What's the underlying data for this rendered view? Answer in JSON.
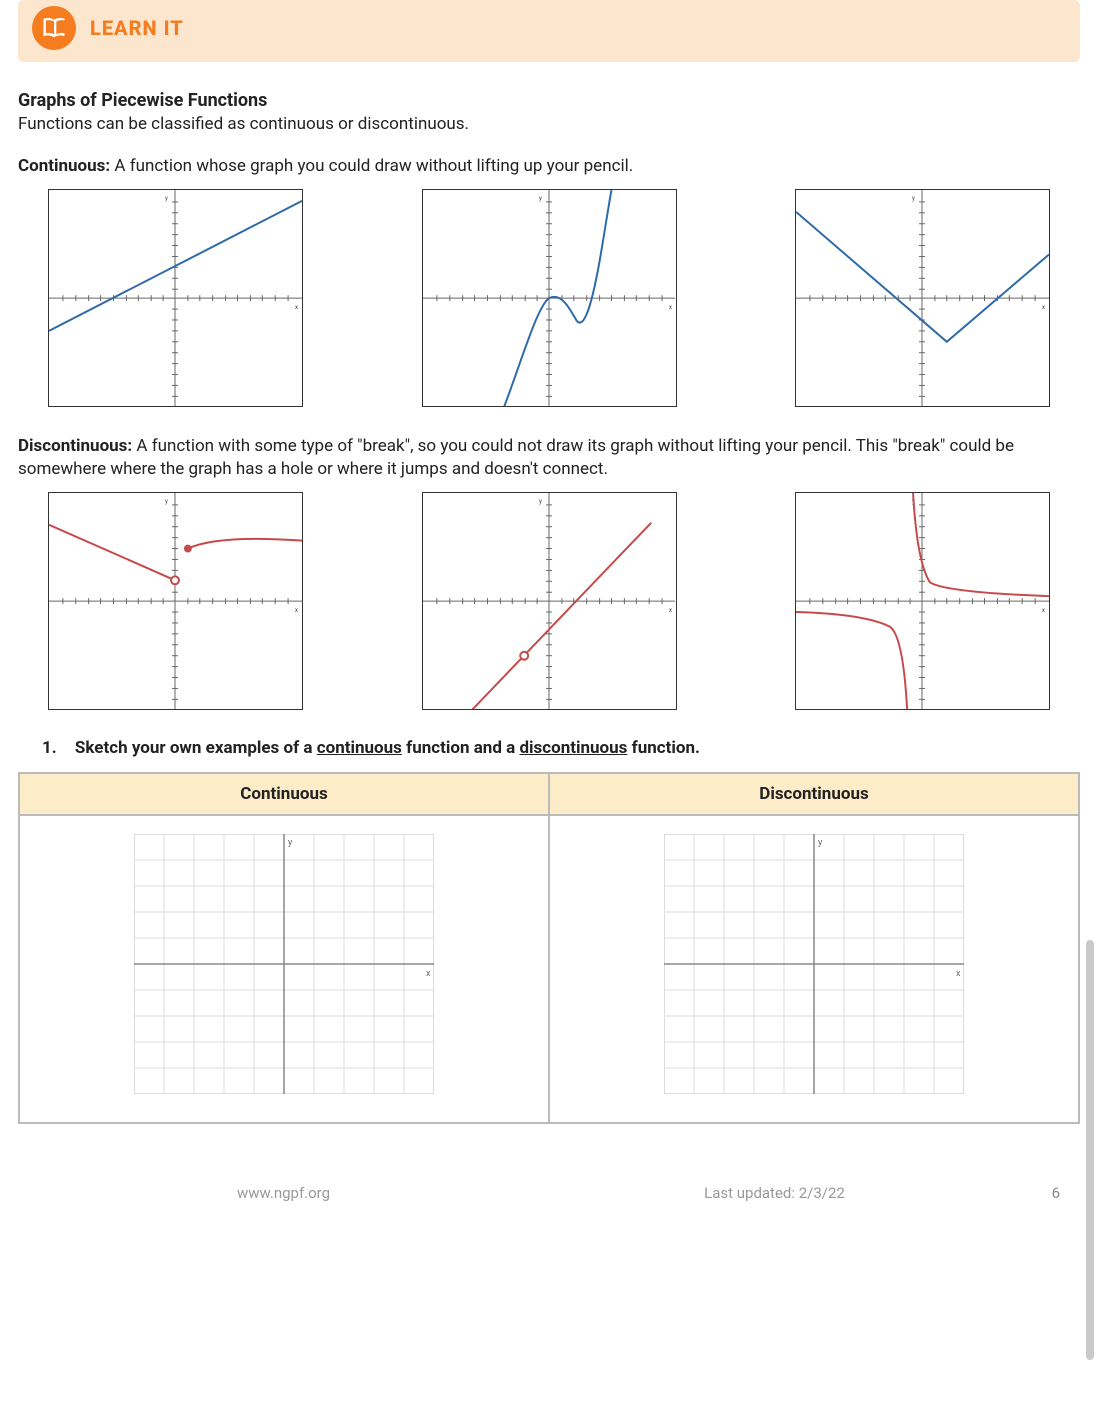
{
  "banner": {
    "title": "LEARN IT"
  },
  "section": {
    "title": "Graphs of Piecewise Functions",
    "intro": "Functions can be classified as continuous or discontinuous."
  },
  "continuous": {
    "label": "Continuous:",
    "definition": " A function whose graph you could draw without lifting up your pencil."
  },
  "discontinuous": {
    "label": "Discontinuous:",
    "definition": " A function with some type of \"break\", so you could not draw its graph without lifting your pencil. This \"break\" could be somewhere where the graph has a hole or where it jumps and doesn't connect."
  },
  "question": {
    "number": "1.",
    "prefix": "Sketch your own examples of a ",
    "word1": "continuous",
    "middle": " function and a ",
    "word2": "discontinuous",
    "suffix": " function."
  },
  "table": {
    "headers": [
      "Continuous",
      "Discontinuous"
    ]
  },
  "footer": {
    "site": "www.ngpf.org",
    "updated": "Last updated: 2/3/22",
    "page": "6"
  },
  "chart_data": [
    {
      "type": "line",
      "title": "continuous linear",
      "xlim": [
        -10,
        10
      ],
      "ylim": [
        -10,
        10
      ],
      "series": [
        {
          "name": "f",
          "x": [
            -10,
            10
          ],
          "y": [
            -3,
            9
          ]
        }
      ],
      "color": "#2e6aa8"
    },
    {
      "type": "line",
      "title": "continuous cubic",
      "xlim": [
        -10,
        10
      ],
      "ylim": [
        -10,
        10
      ],
      "series": [
        {
          "name": "f",
          "x": [
            -4,
            -2,
            0,
            1,
            2,
            2.5,
            3,
            3.5,
            4,
            5
          ],
          "y": [
            -10,
            -4,
            0,
            0.5,
            -1,
            -2,
            -1.5,
            1,
            5,
            10
          ]
        }
      ],
      "color": "#2e6aa8"
    },
    {
      "type": "line",
      "title": "continuous absolute value",
      "xlim": [
        -10,
        10
      ],
      "ylim": [
        -10,
        10
      ],
      "series": [
        {
          "name": "f",
          "x": [
            -10,
            2,
            10
          ],
          "y": [
            8,
            -4,
            4
          ]
        }
      ],
      "color": "#2e6aa8"
    },
    {
      "type": "line",
      "title": "discontinuous jump",
      "xlim": [
        -10,
        10
      ],
      "ylim": [
        -10,
        10
      ],
      "series": [
        {
          "name": "left",
          "x": [
            -10,
            0
          ],
          "y": [
            7,
            2
          ],
          "open_end": [
            0,
            2
          ]
        },
        {
          "name": "right",
          "x": [
            1,
            10
          ],
          "y": [
            5,
            6
          ],
          "closed_start": [
            1,
            5
          ]
        }
      ],
      "color": "#c74a4a"
    },
    {
      "type": "line",
      "title": "discontinuous hole",
      "xlim": [
        -10,
        10
      ],
      "ylim": [
        -10,
        10
      ],
      "series": [
        {
          "name": "f",
          "x": [
            -6,
            10
          ],
          "y": [
            -10,
            6
          ],
          "hole": [
            -2,
            -6
          ]
        }
      ],
      "color": "#c74a4a"
    },
    {
      "type": "line",
      "title": "discontinuous asymptote",
      "xlim": [
        -10,
        10
      ],
      "ylim": [
        -10,
        10
      ],
      "series": [
        {
          "name": "left",
          "x": [
            -10,
            -4,
            -2,
            -1.2,
            -1.05
          ],
          "y": [
            -1,
            -1.2,
            -2,
            -5,
            -10
          ]
        },
        {
          "name": "right",
          "x": [
            -0.95,
            -0.8,
            0,
            2,
            10
          ],
          "y": [
            10,
            5,
            1.5,
            0.6,
            0.2
          ]
        }
      ],
      "color": "#c74a4a",
      "vasymptote": -1
    }
  ]
}
